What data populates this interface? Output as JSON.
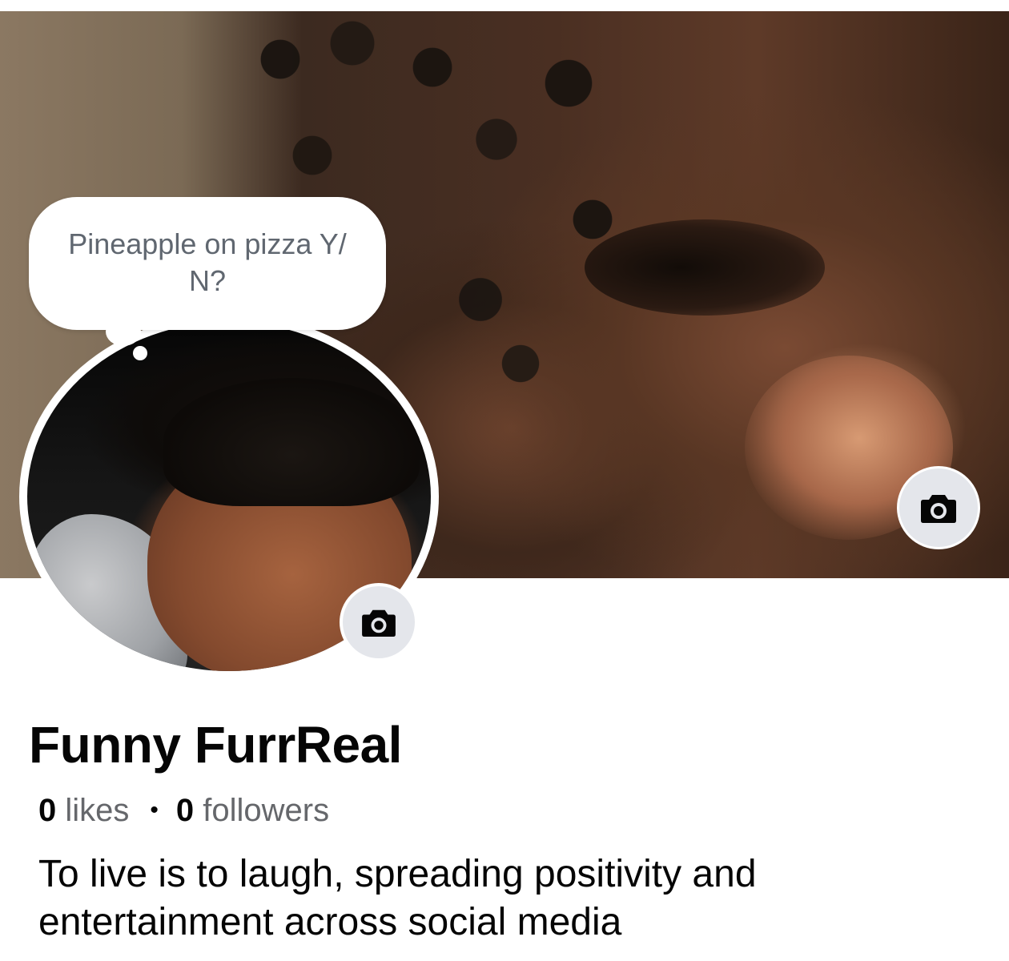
{
  "profile": {
    "name": "Funny FurrReal",
    "status_bubble": "Pineapple on pizza Y/ N?",
    "stats": {
      "likes_count": "0",
      "likes_label": " likes",
      "separator": "•",
      "followers_count": "0",
      "followers_label": " followers"
    },
    "bio": "To live is to laugh, spreading positivity and entertainment across social media"
  },
  "icons": {
    "cover_camera": "camera-icon",
    "avatar_camera": "camera-icon"
  },
  "colors": {
    "icon_button_bg": "#e4e6eb",
    "text_primary": "#050505",
    "text_secondary": "#65676b"
  }
}
